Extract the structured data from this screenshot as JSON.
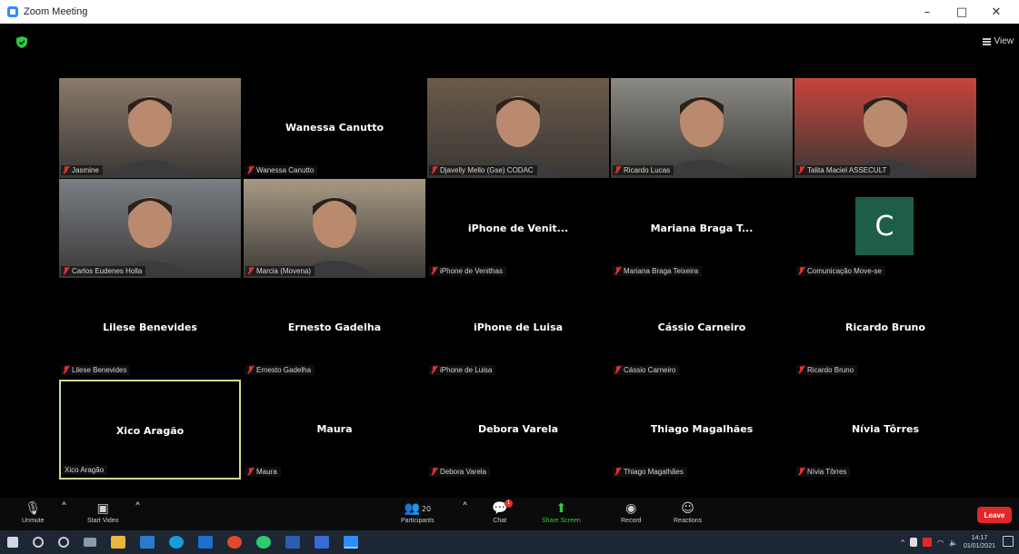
{
  "window": {
    "title": "Zoom Meeting",
    "controls": [
      "–",
      "□",
      "✕"
    ]
  },
  "view_button": "View",
  "tiles": [
    {
      "label": "Jasmine",
      "center": "",
      "type": "video",
      "color": "#8a7a6a"
    },
    {
      "label": "Wanessa Canutto",
      "center": "Wanessa Canutto",
      "type": "name"
    },
    {
      "label": "Djavelly Mello (Gse) CODAC",
      "center": "",
      "type": "video",
      "color": "#6b5a4a"
    },
    {
      "label": "Ricardo Lucas",
      "center": "",
      "type": "video",
      "color": "#8b8a84"
    },
    {
      "label": "Talita Maciel ASSECULT",
      "center": "",
      "type": "video",
      "color": "#c8443a"
    },
    {
      "label": "Carlos Eudenes Holla",
      "center": "",
      "type": "video",
      "color": "#7a7f86"
    },
    {
      "label": "Marcia (Movena)",
      "center": "",
      "type": "video",
      "color": "#a79a84"
    },
    {
      "label": "iPhone de Venithas",
      "center": "iPhone de Venit...",
      "type": "name"
    },
    {
      "label": "Mariana Braga Teixeira",
      "center": "Mariana Braga T...",
      "type": "name"
    },
    {
      "label": "Comunicação Move-se",
      "center": "",
      "type": "avatar",
      "initial": "C"
    },
    {
      "label": "Lilese Benevides",
      "center": "Lilese Benevides",
      "type": "name"
    },
    {
      "label": "Ernesto Gadelha",
      "center": "Ernesto Gadelha",
      "type": "name"
    },
    {
      "label": "iPhone de Luisa",
      "center": "iPhone de Luisa",
      "type": "name"
    },
    {
      "label": "Cássio Carneiro",
      "center": "Cássio Carneiro",
      "type": "name"
    },
    {
      "label": "Ricardo Bruno",
      "center": "Ricardo Bruno",
      "type": "name"
    },
    {
      "label": "Xico Aragão",
      "center": "Xico Aragão",
      "type": "name",
      "active": true,
      "unmuted": true
    },
    {
      "label": "Maura",
      "center": "Maura",
      "type": "name"
    },
    {
      "label": "Debora Varela",
      "center": "Debora Varela",
      "type": "name"
    },
    {
      "label": "Thiago Magalhães",
      "center": "Thiago Magalhães",
      "type": "name"
    },
    {
      "label": "Nívia Tôrres",
      "center": "Nívia Tôrres",
      "type": "name"
    }
  ],
  "toolbar": {
    "unmute": "Unmute",
    "start_video": "Start Video",
    "participants": "Participants",
    "participants_count": "20",
    "chat": "Chat",
    "chat_badge": "1",
    "share_screen": "Share Screen",
    "record": "Record",
    "reactions": "Reactions",
    "leave": "Leave"
  },
  "taskbar": {
    "time": "14:17",
    "date": "01/01/2021"
  },
  "colors": {
    "leave": "#e02828",
    "share": "#2ecc40",
    "active_border": "#d6d98a",
    "avatar_bg": "#1f5e46"
  }
}
